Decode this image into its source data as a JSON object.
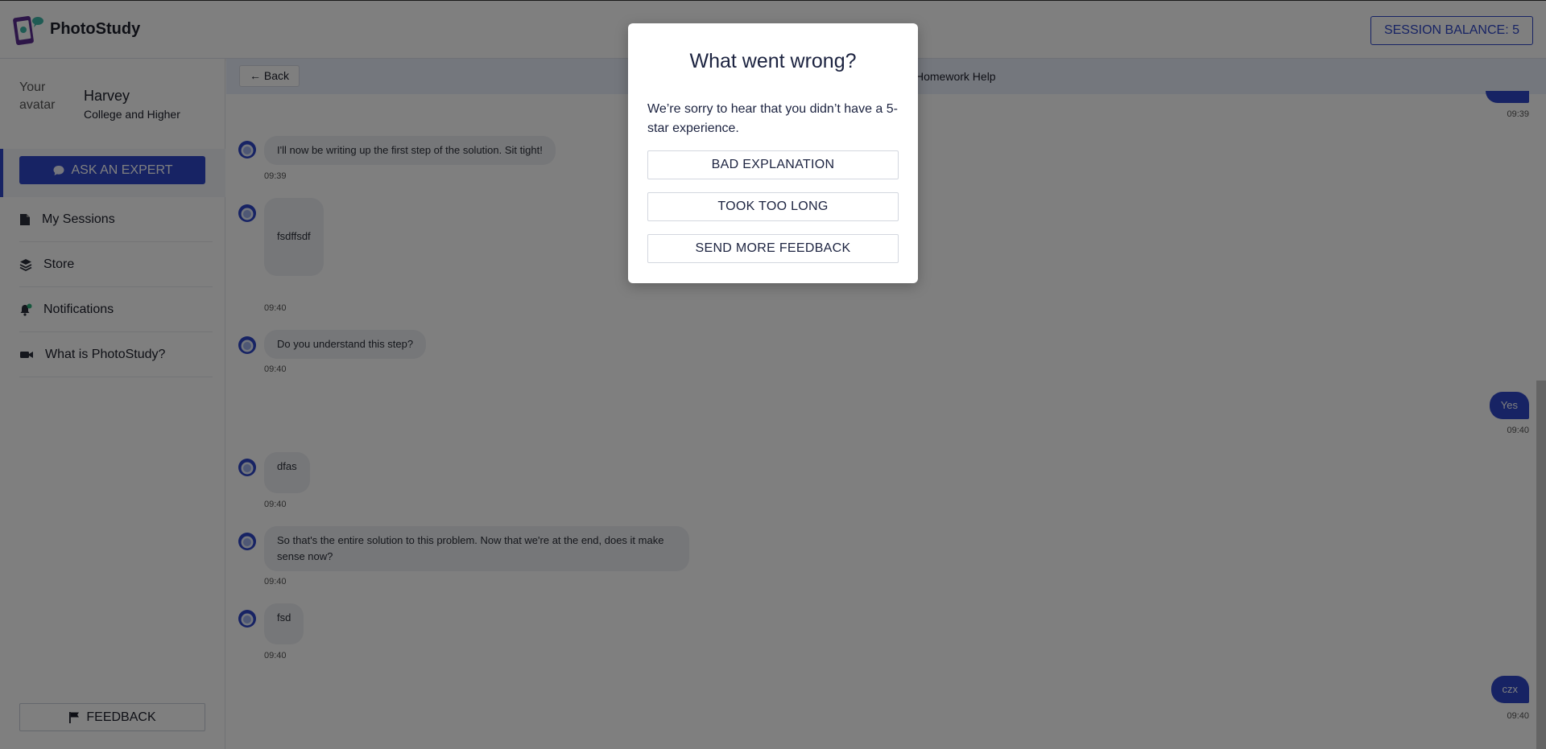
{
  "header": {
    "brand": "PhotoStudy",
    "session_balance": "SESSION BALANCE: 5"
  },
  "sidebar": {
    "avatar_alt": "Your avatar",
    "user_name": "Harvey",
    "user_level": "College and Higher",
    "ask_button": "ASK AN EXPERT",
    "nav": [
      {
        "label": "My Sessions",
        "icon": "document-icon"
      },
      {
        "label": "Store",
        "icon": "layers-icon"
      },
      {
        "label": "Notifications",
        "icon": "bell-icon"
      },
      {
        "label": "What is PhotoStudy?",
        "icon": "video-icon"
      }
    ],
    "feedback_button": "FEEDBACK"
  },
  "chat": {
    "back_label": "← Back",
    "subject": "Homework Help",
    "messages": [
      {
        "from": "user",
        "text": "",
        "time": "09:39"
      },
      {
        "from": "bot",
        "text": "I'll now be writing up the first step of the solution. Sit tight!",
        "time": "09:39"
      },
      {
        "from": "bot",
        "text": "fsdffsdf",
        "time": "09:40"
      },
      {
        "from": "bot",
        "text": "Do you understand this step?",
        "time": "09:40"
      },
      {
        "from": "user",
        "text": "Yes",
        "time": "09:40"
      },
      {
        "from": "bot",
        "text": "dfas",
        "time": "09:40"
      },
      {
        "from": "bot",
        "text": "So that's the entire solution to this problem. Now that we're at the end, does it make sense now?",
        "time": "09:40"
      },
      {
        "from": "bot",
        "text": "fsd",
        "time": "09:40"
      },
      {
        "from": "user",
        "text": "czx",
        "time": "09:40"
      }
    ]
  },
  "modal": {
    "title": "What went wrong?",
    "text": "We’re sorry to hear that you didn’t have a 5-star experience.",
    "buttons": [
      "BAD EXPLANATION",
      "TOOK TOO LONG",
      "SEND MORE FEEDBACK"
    ]
  },
  "colors": {
    "accent": "#2f47c9",
    "overlay": "rgba(0,0,0,0.5)"
  }
}
